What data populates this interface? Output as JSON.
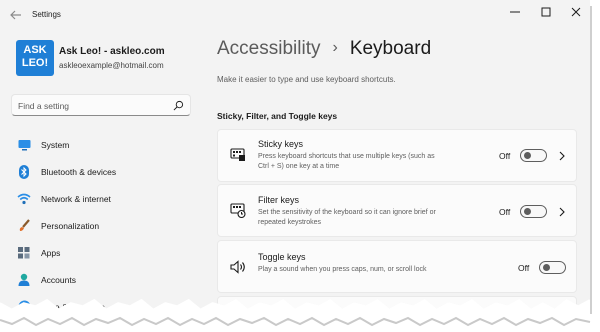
{
  "window": {
    "title": "Settings",
    "controls": [
      "minimize-icon",
      "maximize-icon",
      "close-icon"
    ]
  },
  "profile": {
    "avatar_text": "ASK\nLEO!",
    "name": "Ask Leo! - askleo.com",
    "email": "askleoexample@hotmail.com"
  },
  "search": {
    "placeholder": "Find a setting",
    "value": ""
  },
  "nav": {
    "items": [
      {
        "label": "System",
        "icon": "monitor-icon"
      },
      {
        "label": "Bluetooth & devices",
        "icon": "bluetooth-icon"
      },
      {
        "label": "Network & internet",
        "icon": "wifi-icon"
      },
      {
        "label": "Personalization",
        "icon": "brush-icon"
      },
      {
        "label": "Apps",
        "icon": "apps-icon"
      },
      {
        "label": "Accounts",
        "icon": "person-icon"
      },
      {
        "label": "Time & language",
        "icon": "clock-globe-icon"
      }
    ]
  },
  "breadcrumb": {
    "parent": "Accessibility",
    "separator": "›",
    "current": "Keyboard"
  },
  "subtitle": "Make it easier to type and use keyboard shortcuts.",
  "section": {
    "title": "Sticky, Filter, and Toggle keys"
  },
  "cards": [
    {
      "title": "Sticky keys",
      "description": "Press keyboard shortcuts that use multiple keys (such as Ctrl + S) one key at a time",
      "state": "Off",
      "icon": "sticky-keys-icon",
      "has_chevron": true
    },
    {
      "title": "Filter keys",
      "description": "Set the sensitivity of the keyboard so it can ignore brief or repeated keystrokes",
      "state": "Off",
      "icon": "filter-keys-icon",
      "has_chevron": true
    },
    {
      "title": "Toggle keys",
      "description": "Play a sound when you press caps, num, or scroll lock",
      "state": "Off",
      "icon": "speaker-icon",
      "has_chevron": false
    }
  ],
  "colors": {
    "accent": "#1f7fd6",
    "window_bg": "#f3f3f3",
    "card_bg": "#fbfbfb",
    "toggle_off": "#5e5e5e"
  }
}
